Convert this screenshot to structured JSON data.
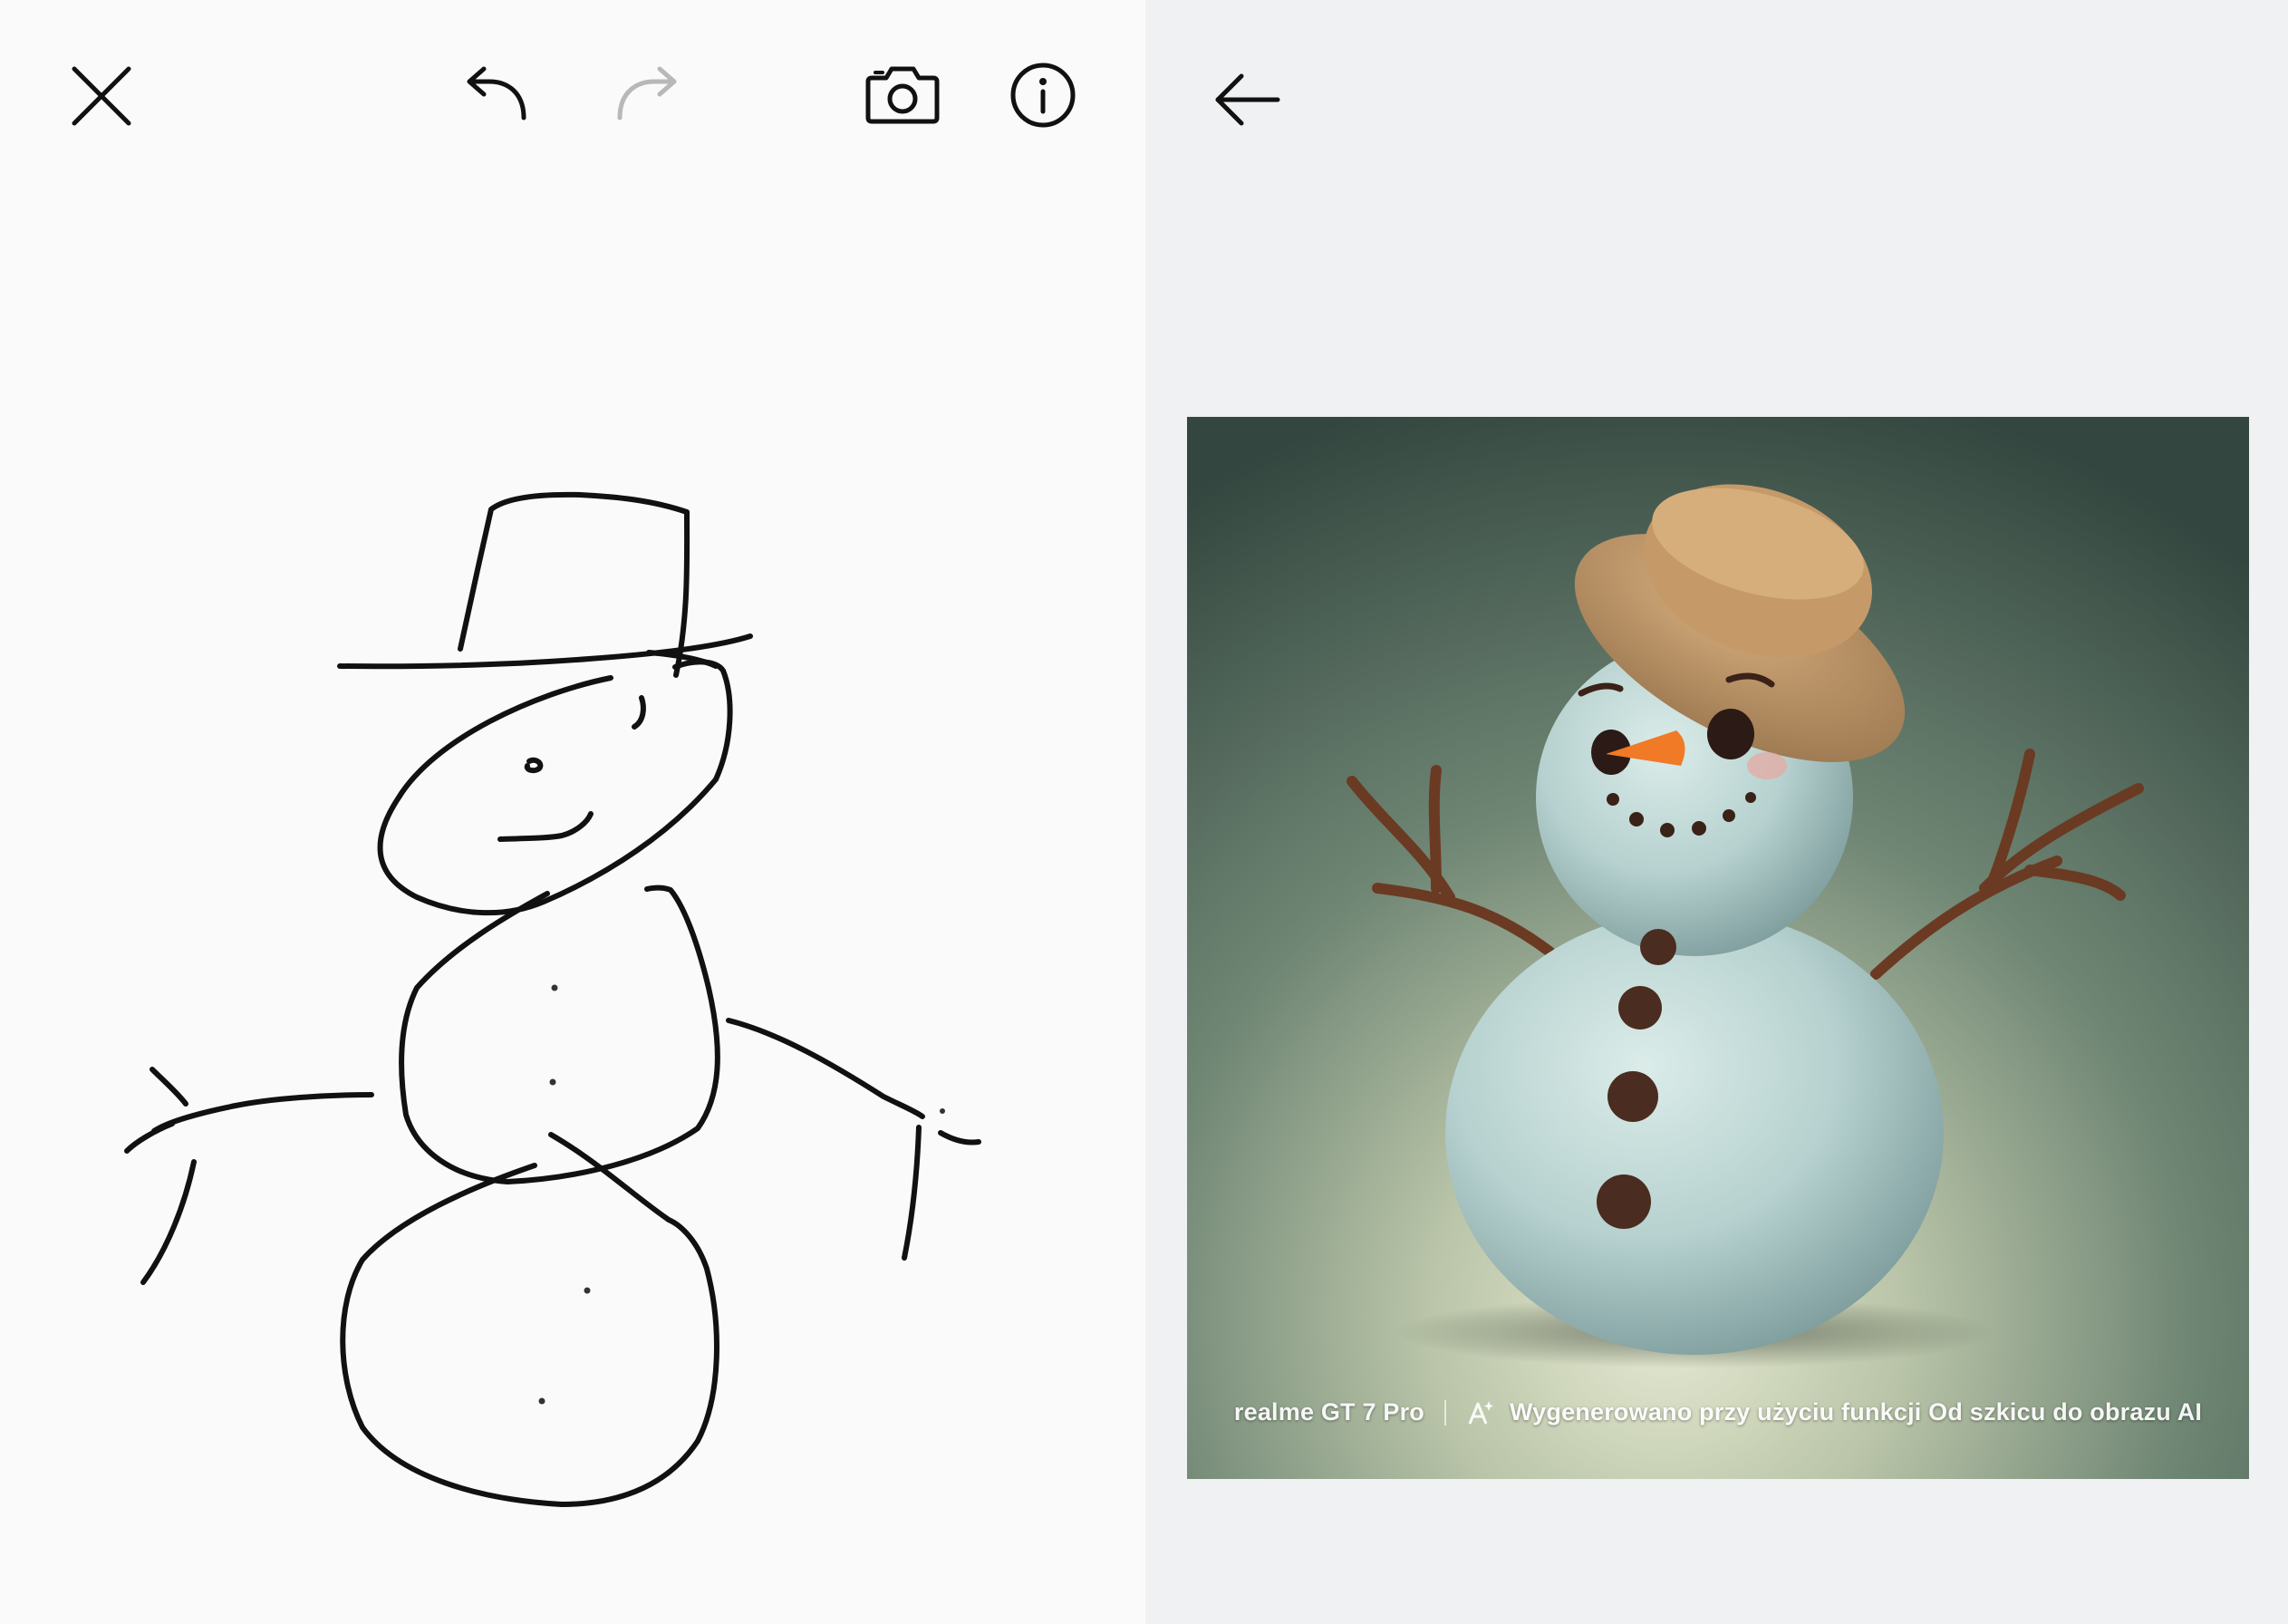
{
  "toolbar": {
    "close_icon": "close-icon",
    "undo_icon": "undo-icon",
    "redo_icon": "redo-icon",
    "redo_enabled": false,
    "camera_icon": "camera-icon",
    "info_icon": "info-icon"
  },
  "result": {
    "back_icon": "back-arrow-icon",
    "watermark": {
      "device": "realme GT 7 Pro",
      "ai_icon": "ai-sparkle-icon",
      "caption": "Wygenerowano przy użyciu funkcji Od szkicu do obrazu AI"
    }
  },
  "colors": {
    "sketch_background": "#fafafa",
    "result_background": "#f0f1f3",
    "ink": "#111111",
    "disabled_icon": "#b8b8b8"
  }
}
